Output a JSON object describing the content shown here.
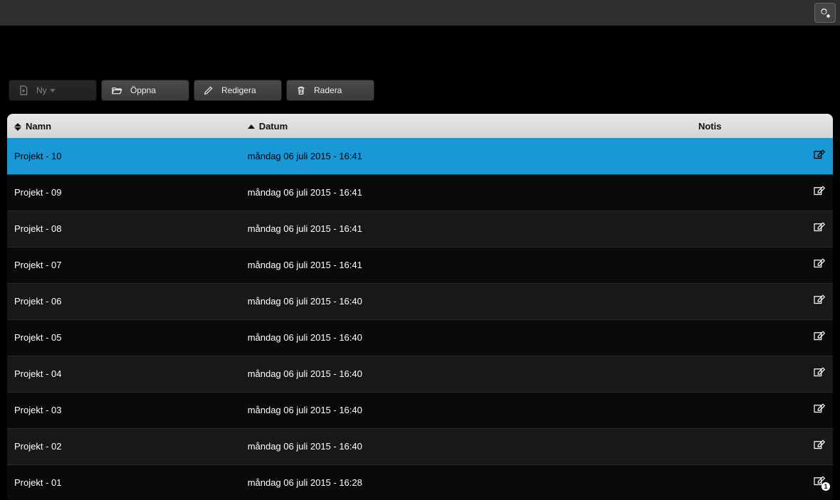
{
  "toolbar": {
    "new_label": "Ny",
    "open_label": "Öppna",
    "edit_label": "Redigera",
    "delete_label": "Radera"
  },
  "columns": {
    "name": "Namn",
    "date": "Datum",
    "notis": "Notis"
  },
  "rows": [
    {
      "name": "Projekt - 10",
      "date": "måndag 06 juli 2015 - 16:41",
      "selected": true,
      "badge": null
    },
    {
      "name": "Projekt - 09",
      "date": "måndag 06 juli 2015 - 16:41",
      "selected": false,
      "badge": null
    },
    {
      "name": "Projekt - 08",
      "date": "måndag 06 juli 2015 - 16:41",
      "selected": false,
      "badge": null
    },
    {
      "name": "Projekt - 07",
      "date": "måndag 06 juli 2015 - 16:41",
      "selected": false,
      "badge": null
    },
    {
      "name": "Projekt - 06",
      "date": "måndag 06 juli 2015 - 16:40",
      "selected": false,
      "badge": null
    },
    {
      "name": "Projekt - 05",
      "date": "måndag 06 juli 2015 - 16:40",
      "selected": false,
      "badge": null
    },
    {
      "name": "Projekt - 04",
      "date": "måndag 06 juli 2015 - 16:40",
      "selected": false,
      "badge": null
    },
    {
      "name": "Projekt - 03",
      "date": "måndag 06 juli 2015 - 16:40",
      "selected": false,
      "badge": null
    },
    {
      "name": "Projekt - 02",
      "date": "måndag 06 juli 2015 - 16:40",
      "selected": false,
      "badge": null
    },
    {
      "name": "Projekt - 01",
      "date": "måndag 06 juli 2015 - 16:28",
      "selected": false,
      "badge": "1"
    }
  ]
}
